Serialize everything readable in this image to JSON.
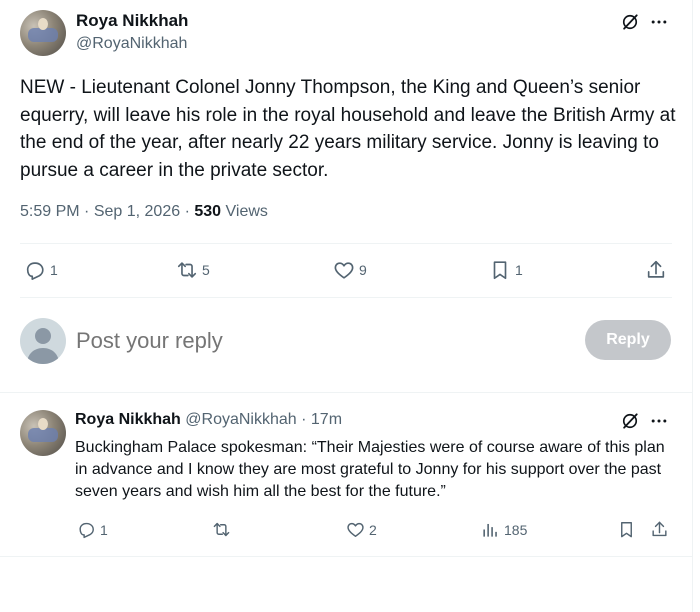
{
  "tweet": {
    "author_name": "Roya Nikkhah",
    "author_handle": "@RoyaNikkhah",
    "text": "NEW - Lieutenant Colonel Jonny Thompson, the King and Queen’s senior equerry, will leave his role in the royal household and leave the British Army at the end of the year, after nearly 22 years military service. Jonny is leaving to pursue a career in the private sector.",
    "time": "5:59 PM",
    "date": "Sep 1, 2026",
    "views_count": "530",
    "views_label": "Views",
    "replies": "1",
    "reposts": "5",
    "likes": "9",
    "bookmarks": "1"
  },
  "reply_box": {
    "placeholder": "Post your reply",
    "button_label": "Reply"
  },
  "reply": {
    "author_name": "Roya Nikkhah",
    "author_handle": "@RoyaNikkhah",
    "age": "17m",
    "text": "Buckingham Palace spokesman: “Their Majesties were of course aware of this plan in advance and I know they are most grateful to Jonny for his support over the past seven years and wish him all the best for the future.”",
    "replies": "1",
    "reposts": "",
    "likes": "2",
    "views": "185"
  },
  "icons": {
    "grok": "grok-icon",
    "more": "more-icon",
    "reply": "reply-icon",
    "repost": "repost-icon",
    "like": "like-icon",
    "bookmark": "bookmark-icon",
    "share": "share-icon",
    "analytics": "analytics-icon"
  },
  "colors": {
    "text": "#0f1419",
    "muted": "#536471",
    "divider": "#eff3f4",
    "reply_button": "#c4c7cb"
  }
}
